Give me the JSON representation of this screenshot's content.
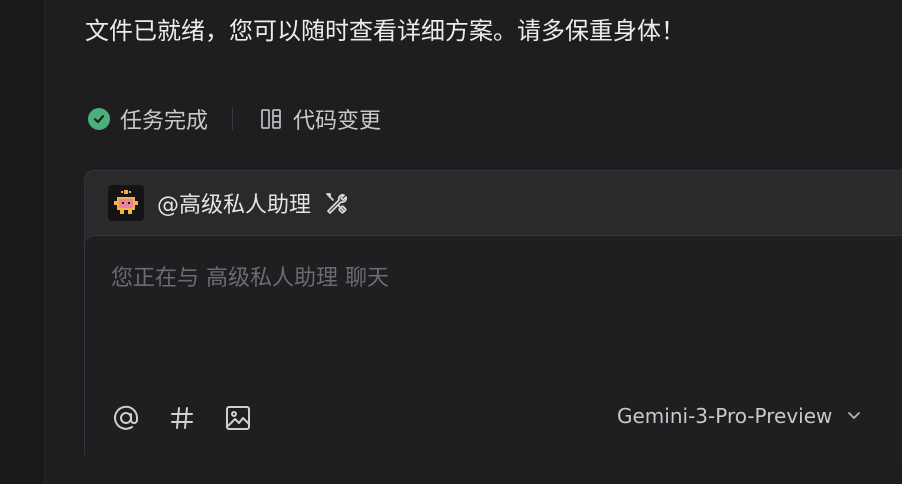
{
  "message": {
    "text": "文件已就绪，您可以随时查看详细方案。请多保重身体！"
  },
  "status": {
    "done_label": "任务完成",
    "changes_label": "代码变更",
    "done_icon": "check-circle-icon",
    "changes_icon": "diff-icon",
    "accent": "#4cb07a"
  },
  "composer": {
    "agent_label": "@高级私人助理",
    "agent_avatar_icon": "robot-avatar-icon",
    "tools_icon": "tools-icon",
    "input_value": "",
    "placeholder": "您正在与 高级私人助理 聊天",
    "toolbar": {
      "mention_icon": "at-icon",
      "topic_icon": "hash-icon",
      "image_icon": "image-icon"
    },
    "model": {
      "selected": "Gemini-3-Pro-Preview",
      "icon": "chevron-down-icon"
    }
  }
}
